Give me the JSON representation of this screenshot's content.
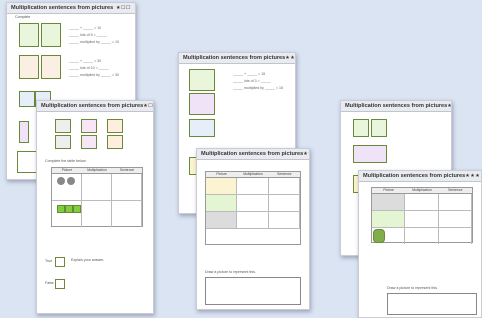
{
  "sheets": [
    {
      "title": "Multiplication sentences from pictures",
      "stars": "★☐☐"
    },
    {
      "title": "Multiplication sentences from pictures",
      "stars": "★☐☐"
    },
    {
      "title": "Multiplication sentences from pictures",
      "stars": "★★☐"
    },
    {
      "title": "Multiplication sentences from pictures",
      "stars": "★★☐"
    },
    {
      "title": "Multiplication sentences from pictures",
      "stars": "★★★"
    },
    {
      "title": "Multiplication sentences from pictures",
      "stars": "★★★"
    }
  ],
  "labels": {
    "complete": "Complete",
    "lines": "_____ + _____ = 10\n_____ lots of 5 = _____\n_____ multiplied by _____ = 10",
    "lines2": "_____ + _____ = 30\n_____ lots of 10 = _____\n_____ multiplied by _____ = 30",
    "lines3": "_____ + _____ = 15\n_____ lots of 3 = _____\n_____ multiplied by _____ = 15",
    "true": "True",
    "false": "False",
    "explain": "Explain your answer.",
    "picture": "Picture",
    "multiplication": "Multiplication",
    "sentence": "Sentence",
    "complete_table": "Complete the table below.",
    "draw": "Draw a picture to represent this."
  },
  "colors": {
    "green": "#7fcf3a",
    "orange": "#d8732a",
    "blue": "#6f9fd8",
    "purple": "#8a3fa8",
    "yellow": "#e8c83a",
    "grey": "#888"
  }
}
